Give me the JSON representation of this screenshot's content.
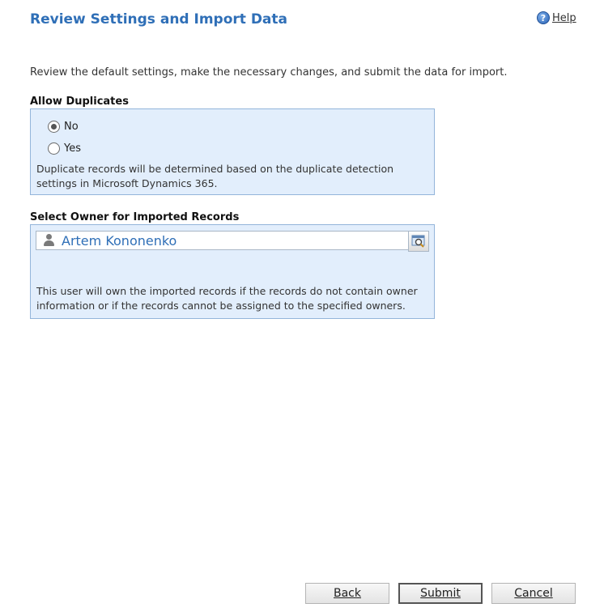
{
  "header": {
    "title": "Review Settings and Import Data",
    "help_label": "Help",
    "help_glyph": "?"
  },
  "intro": "Review the default settings, make the necessary changes, and submit the data for import.",
  "allow_duplicates": {
    "label": "Allow Duplicates",
    "options": [
      {
        "label": "No",
        "selected": true
      },
      {
        "label": "Yes",
        "selected": false
      }
    ],
    "note": "Duplicate records will be determined based on the duplicate detection settings in Microsoft Dynamics 365."
  },
  "owner": {
    "label": "Select Owner for Imported Records",
    "value": "Artem Kononenko",
    "note": "This user will own the imported records if the records do not contain owner information or if the records cannot be assigned to the specified owners."
  },
  "buttons": {
    "back": "Back",
    "submit": "Submit",
    "cancel": "Cancel"
  },
  "colors": {
    "title": "#2f6fb7",
    "panel_bg": "#e2eefc",
    "panel_border": "#93b5da"
  },
  "icons": {
    "help": "help-icon",
    "user": "user-icon",
    "lookup": "lookup-search-icon"
  }
}
